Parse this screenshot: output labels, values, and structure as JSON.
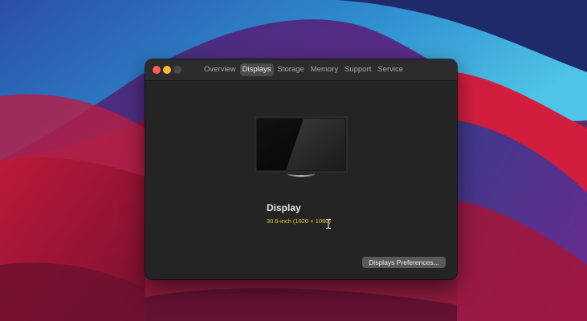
{
  "tabs": [
    "Overview",
    "Displays",
    "Storage",
    "Memory",
    "Support",
    "Service"
  ],
  "active_tab": "Displays",
  "display": {
    "title": "Display",
    "resolution": "30.5-inch (1920 × 1080)"
  },
  "buttons": {
    "preferences": "Displays Preferences..."
  },
  "icons": {
    "monitor": "monitor-icon",
    "close": "close-button",
    "minimize": "minimize-button",
    "zoom": "zoom-button"
  },
  "colors": {
    "close": "#ff5f57",
    "minimize": "#febc2e",
    "window_bg": "#242424",
    "resolution_text": "#d9d21a"
  }
}
